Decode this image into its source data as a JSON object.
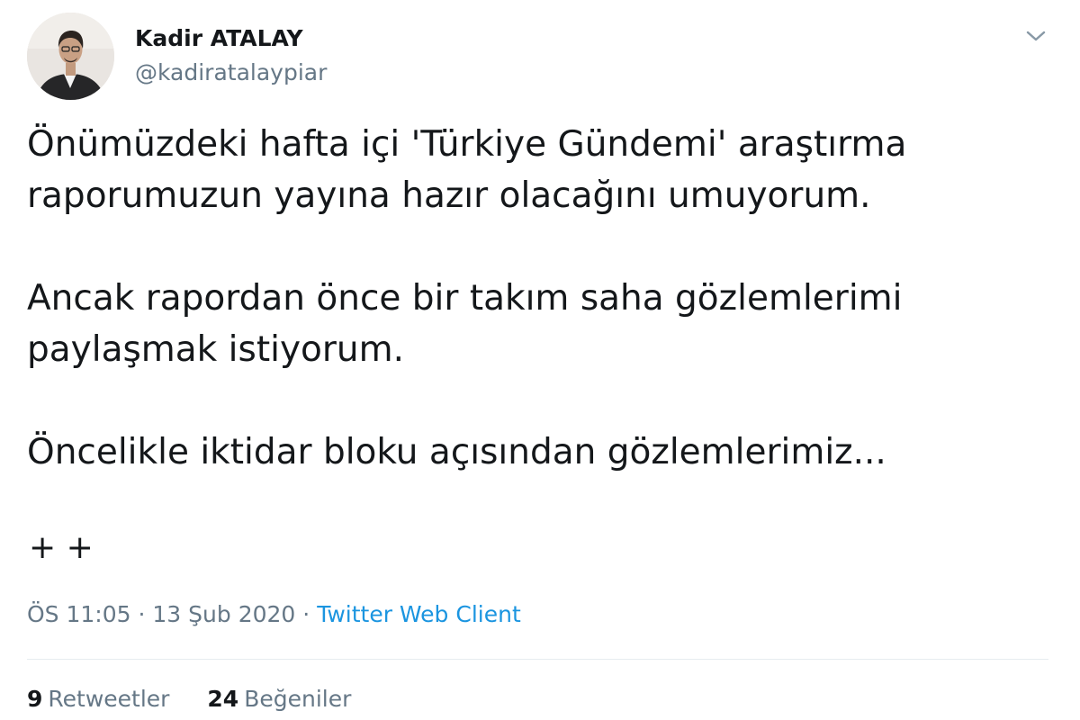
{
  "author": {
    "name": "Kadir ATALAY",
    "handle": "@kadiratalaypiar"
  },
  "tweet": {
    "paragraphs": [
      {
        "line1": "Önümüzdeki hafta içi 'Türkiye Gündemi' araştırma",
        "line2": "raporumuzun yayına hazır olacağını umuyorum."
      },
      {
        "line1": "Ancak rapordan önce bir takım saha gözlemlerimi",
        "line2": "paylaşmak istiyorum."
      },
      {
        "line1": "Öncelikle iktidar bloku açısından gözlemlerimiz..."
      }
    ],
    "continuation": "+ +"
  },
  "meta": {
    "time": "ÖS 11:05",
    "date": "13 Şub 2020",
    "separator": "·",
    "source": "Twitter Web Client"
  },
  "stats": {
    "retweets_count": "9",
    "retweets_label": "Retweetler",
    "likes_count": "24",
    "likes_label": "Beğeniler"
  },
  "icons": {
    "menu": "chevron-down-icon"
  },
  "colors": {
    "text": "#14171a",
    "secondary": "#657786",
    "link": "#1b95e0",
    "divider": "#e6ecf0"
  }
}
